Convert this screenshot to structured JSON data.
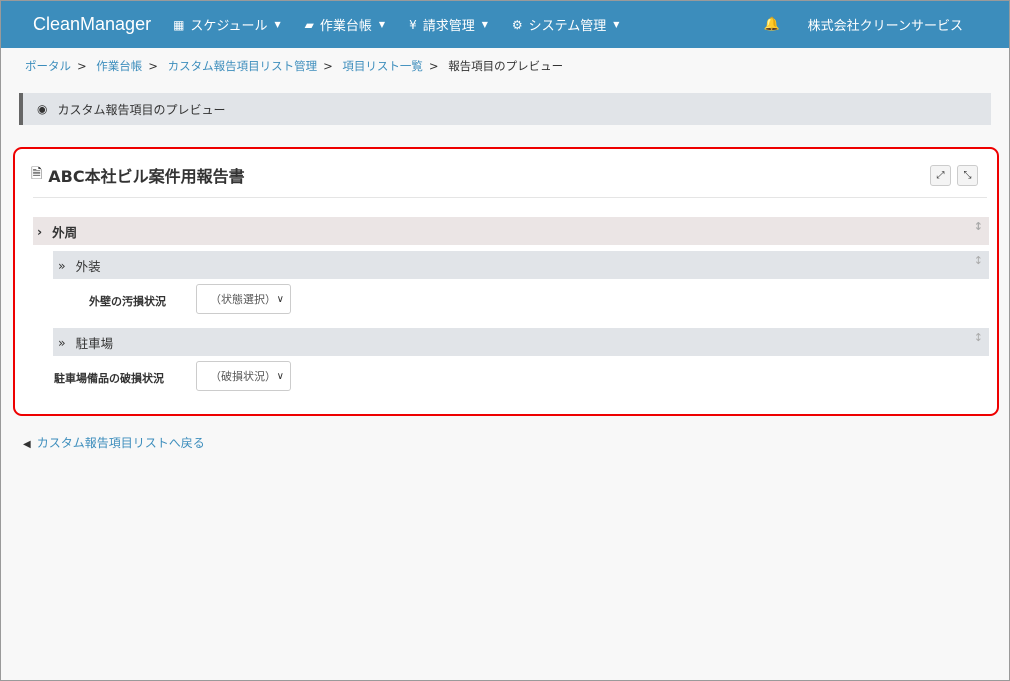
{
  "nav": {
    "brand": "CleanManager",
    "menus": [
      {
        "icon": "▦",
        "label": "スケジュール"
      },
      {
        "icon": "▰",
        "label": "作業台帳"
      },
      {
        "icon": "¥",
        "label": "請求管理"
      },
      {
        "icon": "⚙",
        "label": "システム管理"
      }
    ],
    "bell": "🔔",
    "company": "株式会社クリーンサービス",
    "caret": "▼"
  },
  "breadcrumb": {
    "items": [
      "ポータル",
      "作業台帳",
      "カスタム報告項目リスト管理",
      "項目リスト一覧"
    ],
    "current": "報告項目のプレビュー",
    "sep": ">"
  },
  "page_header": "カスタム報告項目のプレビュー",
  "card": {
    "title": "ABC本社ビル案件用報告書",
    "expand": "⤢",
    "compress": "⤡",
    "section": {
      "label": "外周",
      "subsections": [
        {
          "label": "外装",
          "field": {
            "label": "外壁の汚損状況",
            "value": "（状態選択）"
          }
        },
        {
          "label": "駐車場",
          "field": {
            "label": "駐車場備品の破損状況",
            "value": "（破損状況）"
          }
        }
      ]
    }
  },
  "back_link": "カスタム報告項目リストへ戻る"
}
